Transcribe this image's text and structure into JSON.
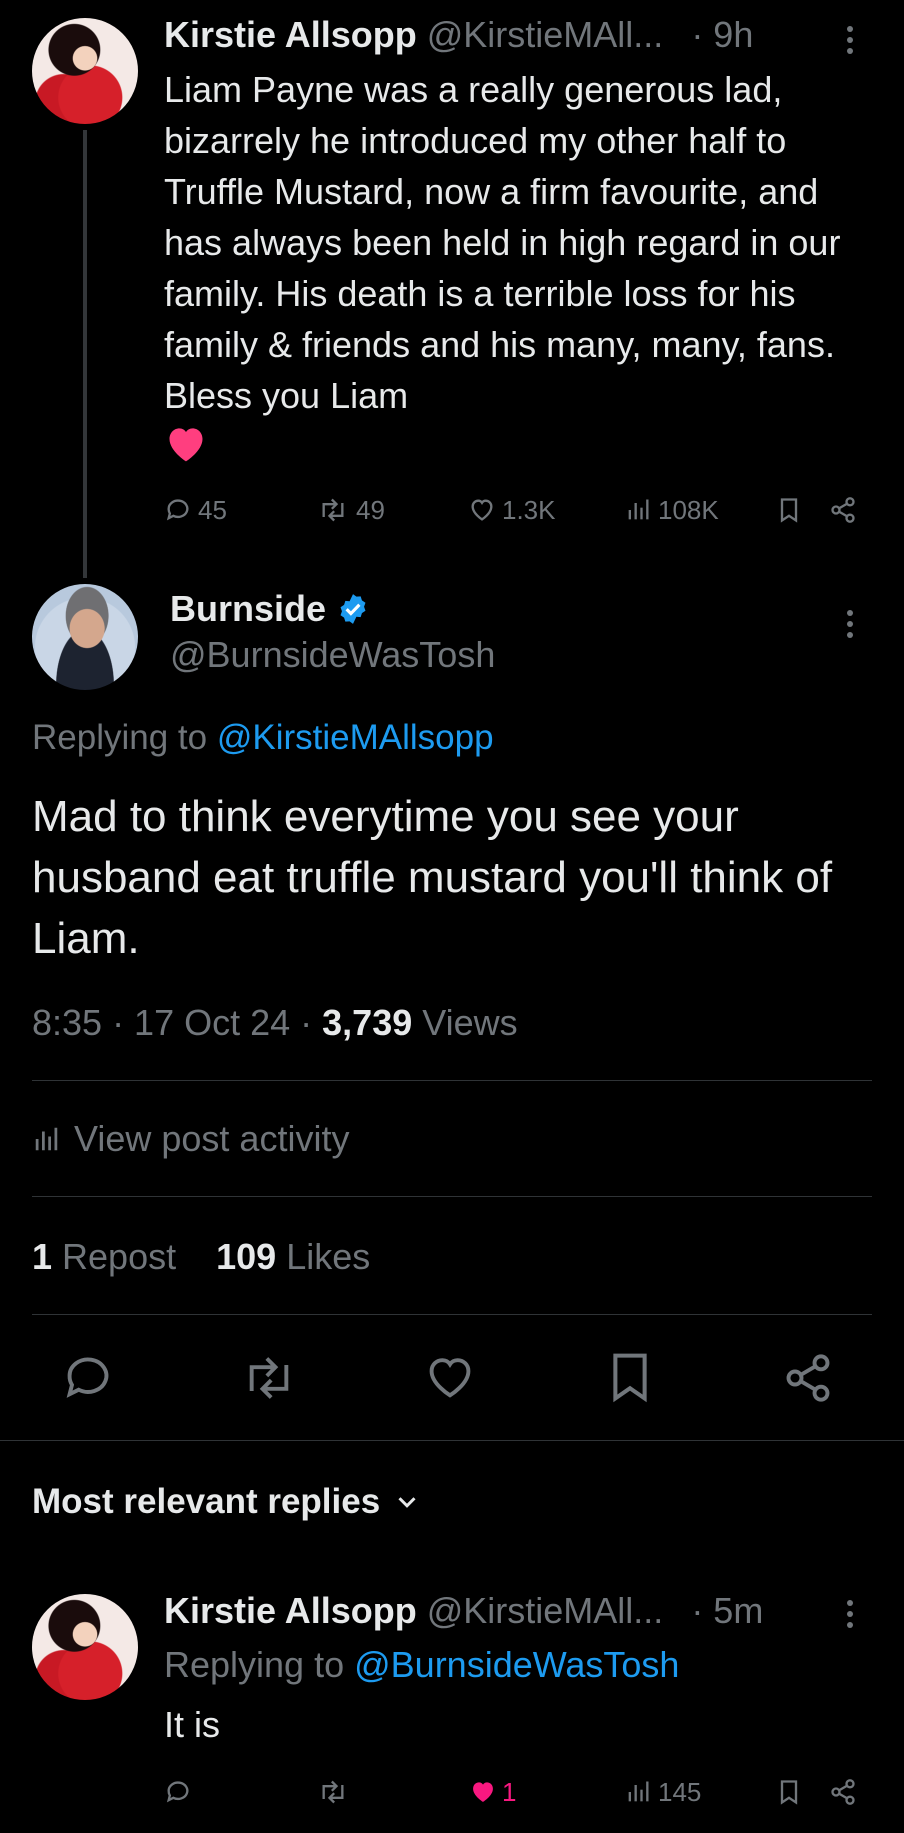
{
  "parent_tweet": {
    "author_name": "Kirstie Allsopp",
    "author_handle": "@KirstieMAll...",
    "time": "· 9h",
    "text": "Liam Payne was a really generous lad, bizarrely he introduced my other half to Truffle Mustard, now a firm favourite, and has always been held in high regard in our family. His death is a terrible loss for his family & friends and his many, many, fans. Bless you Liam",
    "emoji": "heart-emoji",
    "actions": {
      "replies": "45",
      "reposts": "49",
      "likes": "1.3K",
      "views": "108K"
    }
  },
  "main_tweet": {
    "author_name": "Burnside",
    "author_handle": "@BurnsideWasTosh",
    "verified": true,
    "replying_label": "Replying to ",
    "replying_handle": "@KirstieMAllsopp",
    "text": "Mad to think everytime you see your husband eat truffle mustard you'll think of Liam.",
    "time": "8:35 · 17 Oct 24 · ",
    "views_count": "3,739",
    "views_label": " Views",
    "activity_label": "View post activity",
    "reposts_count": "1",
    "reposts_label": " Repost",
    "likes_count": "109",
    "likes_label": " Likes"
  },
  "replies_section": {
    "sort_label": "Most relevant replies"
  },
  "reply": {
    "author_name": "Kirstie Allsopp",
    "author_handle": "@KirstieMAll...",
    "time": "· 5m",
    "replying_label": "Replying to ",
    "replying_handle": "@BurnsideWasTosh",
    "text": "It is",
    "actions": {
      "likes": "1",
      "views": "145"
    }
  },
  "colors": {
    "background": "#000000",
    "text": "#e7e9ea",
    "secondary": "#71767b",
    "link": "#1d9bf0",
    "like": "#f91880"
  }
}
